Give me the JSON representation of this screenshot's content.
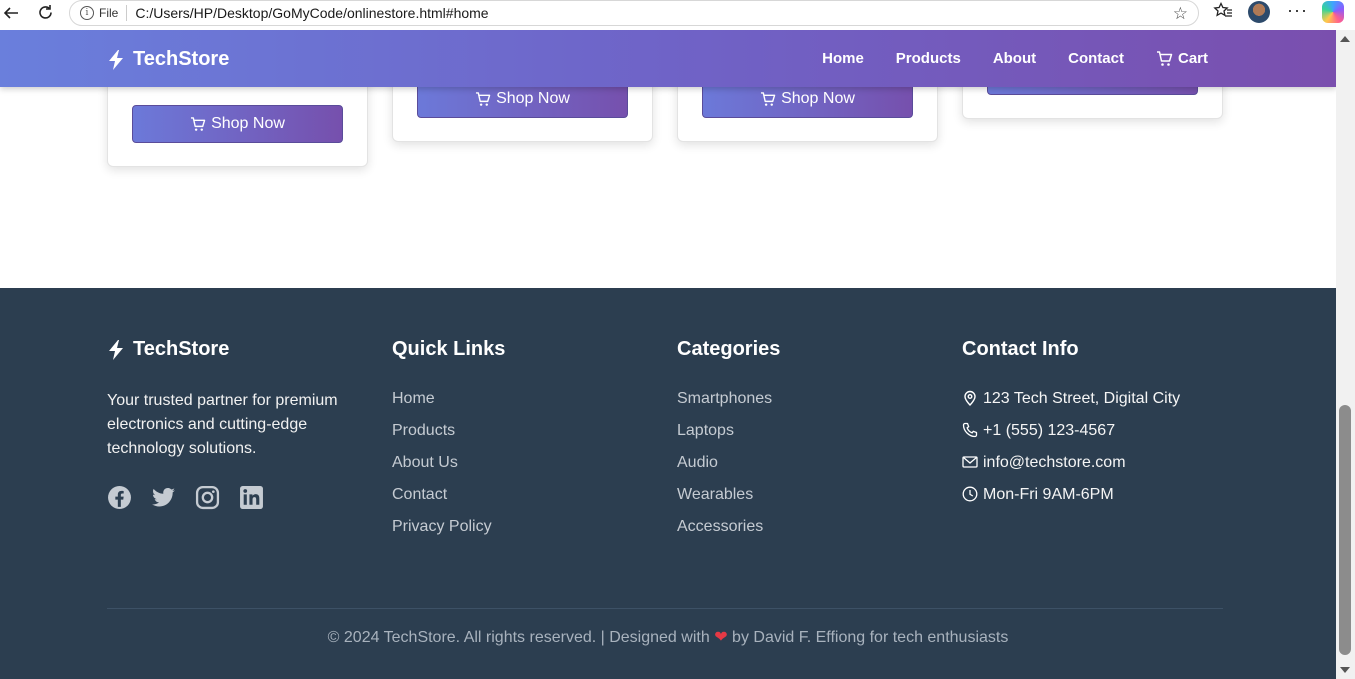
{
  "browser": {
    "file_label": "File",
    "url": "C:/Users/HP/Desktop/GoMyCode/onlinestore.html#home"
  },
  "nav": {
    "brand": "TechStore",
    "links": [
      "Home",
      "Products",
      "About",
      "Contact"
    ],
    "cart": "Cart"
  },
  "products": {
    "shop_label": "Shop Now"
  },
  "footer": {
    "brand": "TechStore",
    "about": "Your trusted partner for premium electronics and cutting-edge technology solutions.",
    "quick_links": {
      "heading": "Quick Links",
      "items": [
        "Home",
        "Products",
        "About Us",
        "Contact",
        "Privacy Policy"
      ]
    },
    "categories": {
      "heading": "Categories",
      "items": [
        "Smartphones",
        "Laptops",
        "Audio",
        "Wearables",
        "Accessories"
      ]
    },
    "contact": {
      "heading": "Contact Info",
      "address": "123 Tech Street, Digital City",
      "phone": "+1 (555) 123-4567",
      "email": "info@techstore.com",
      "hours": "Mon-Fri 9AM-6PM"
    },
    "copyright_pre": "© 2024 TechStore. All rights reserved. | Designed with",
    "heart": "❤",
    "copyright_post": "by David F. Effiong for tech enthusiasts"
  },
  "colors": {
    "footer_bg": "#2c3e50",
    "nav_gradient_start": "#6a7fdc",
    "nav_gradient_end": "#7a4fae"
  }
}
